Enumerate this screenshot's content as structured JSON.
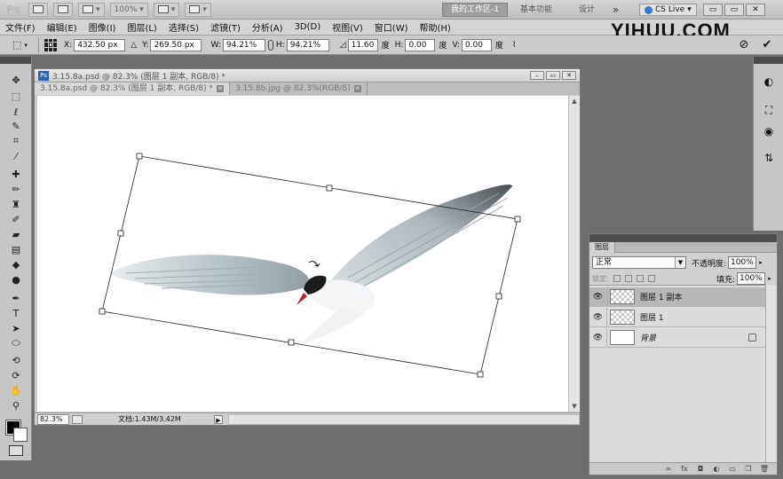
{
  "app": {
    "logo": "Ps",
    "zoom_preset": "100%",
    "workspaces": {
      "active": "我的工作区-1",
      "essentials": "基本功能",
      "design": "设计",
      "more": "»"
    },
    "cs_live": "CS Live",
    "window_buttons": [
      "▭",
      "▭",
      "✕"
    ]
  },
  "watermark": "YIHUU.COM",
  "menu": {
    "items": [
      "文件(F)",
      "编辑(E)",
      "图像(I)",
      "图层(L)",
      "选择(S)",
      "滤镜(T)",
      "分析(A)",
      "3D(D)",
      "视图(V)",
      "窗口(W)",
      "帮助(H)"
    ]
  },
  "options": {
    "x_label": "X:",
    "x_value": "432.50 px",
    "y_label": "Y:",
    "y_value": "269.50 px",
    "w_label": "W:",
    "w_value": "94.21%",
    "h_label": "H:",
    "h_value": "94.21%",
    "angle_value": "11.60",
    "angle_unit": "度",
    "skew_h_label": "H:",
    "skew_h_value": "0.00",
    "skew_h_unit": "度",
    "skew_v_label": "V:",
    "skew_v_value": "0.00",
    "skew_v_unit": "度",
    "cancel": "⊘",
    "commit": "✔"
  },
  "document": {
    "window_title": "3.15.8a.psd @ 82.3% (图层 1 副本, RGB/8) *",
    "tabs": [
      {
        "label": "3.15.8a.psd @ 82.3% (图层 1 副本, RGB/8) *",
        "close": "✕"
      },
      {
        "label": "3.15.8b.jpg @ 82.3%(RGB/8)",
        "close": "✕"
      }
    ],
    "zoom": "82.3%",
    "doc_size": "文档:1.43M/3.42M",
    "status_arrow": "▶"
  },
  "layers": {
    "tab": "图层",
    "blend_mode": "正常",
    "opacity_label": "不透明度:",
    "opacity_value": "100%",
    "lock_label": "锁定:",
    "fill_label": "填充:",
    "fill_value": "100%",
    "rows": [
      {
        "name": "图层 1 副本"
      },
      {
        "name": "图层 1"
      },
      {
        "name": "背景"
      }
    ]
  },
  "colors": {
    "accent": "#2a62b5",
    "panel": "#c6c6c6",
    "pasteboard": "#c9c9c9"
  }
}
